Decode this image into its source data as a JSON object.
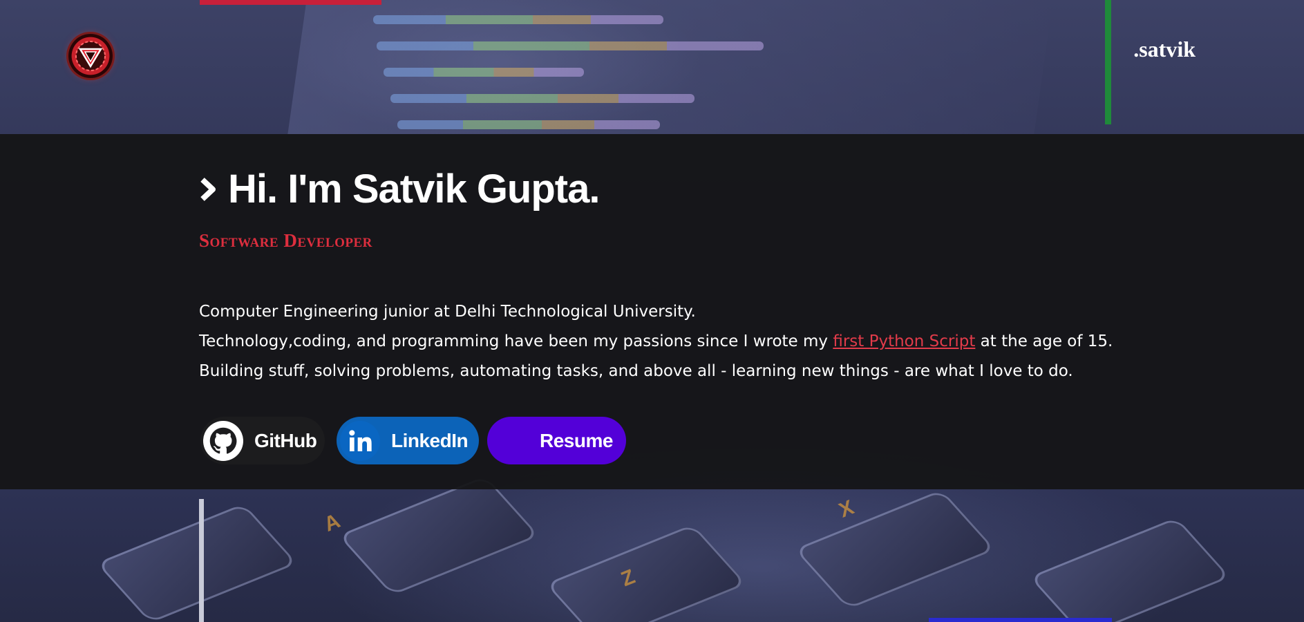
{
  "header": {
    "brand": ".satvik",
    "logo_icon": "arc-reactor-icon"
  },
  "hero": {
    "title": "Hi. I'm Satvik Gupta.",
    "subtitle": "Software Developer",
    "bio": {
      "line1": "Computer Engineering junior at Delhi Technological University.",
      "line2_before": "Technology,coding, and programming have been my passions since I wrote my ",
      "line2_link": "first Python Script",
      "line2_after": " at the age of 15.",
      "line3": "Building stuff, solving problems, automating tasks, and above all - learning new things - are what I love to do."
    }
  },
  "buttons": {
    "github": {
      "label": "GitHub",
      "icon": "github-icon",
      "color": "#1c1c1e"
    },
    "linkedin": {
      "label": "LinkedIn",
      "icon": "linkedin-icon",
      "color": "#0c63b8"
    },
    "resume": {
      "label": "Resume",
      "color": "#5300d8"
    }
  },
  "colors": {
    "accent_red": "#dd2e3e",
    "accent_green": "#1f8a3a",
    "hero_band": "#141416"
  }
}
